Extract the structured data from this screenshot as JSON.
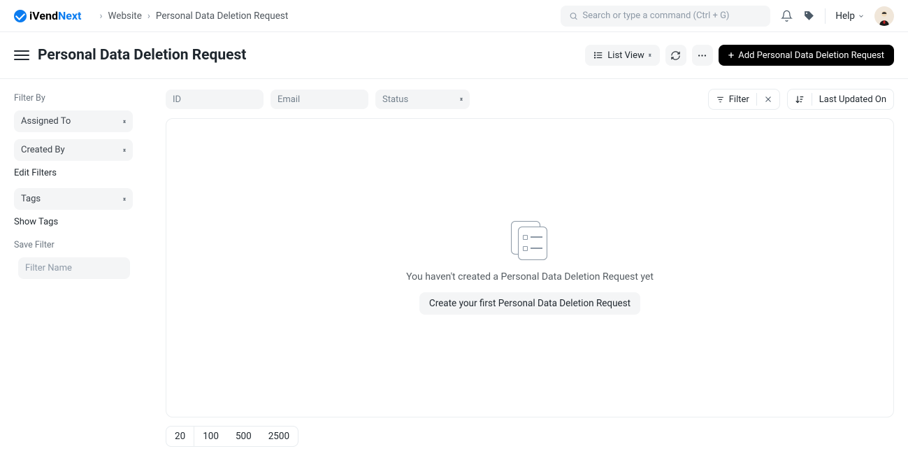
{
  "brand": {
    "part1": "iVend",
    "part2": "Next"
  },
  "breadcrumb": {
    "items": [
      "Website",
      "Personal Data Deletion Request"
    ]
  },
  "search": {
    "placeholder": "Search or type a command (Ctrl + G)"
  },
  "help_label": "Help",
  "page": {
    "title": "Personal Data Deletion Request"
  },
  "header_actions": {
    "view_label": "List View",
    "add_label": "Add Personal Data Deletion Request"
  },
  "sidebar": {
    "filter_by_label": "Filter By",
    "assigned_to_label": "Assigned To",
    "created_by_label": "Created By",
    "edit_filters_label": "Edit Filters",
    "tags_label": "Tags",
    "show_tags_label": "Show Tags",
    "save_filter_label": "Save Filter",
    "filter_name_placeholder": "Filter Name"
  },
  "filters": {
    "id_placeholder": "ID",
    "email_placeholder": "Email",
    "status_label": "Status",
    "filter_button_label": "Filter",
    "sort_label": "Last Updated On"
  },
  "empty_state": {
    "message": "You haven't created a Personal Data Deletion Request yet",
    "cta_label": "Create your first Personal Data Deletion Request"
  },
  "pagination": {
    "options": [
      "20",
      "100",
      "500",
      "2500"
    ]
  }
}
